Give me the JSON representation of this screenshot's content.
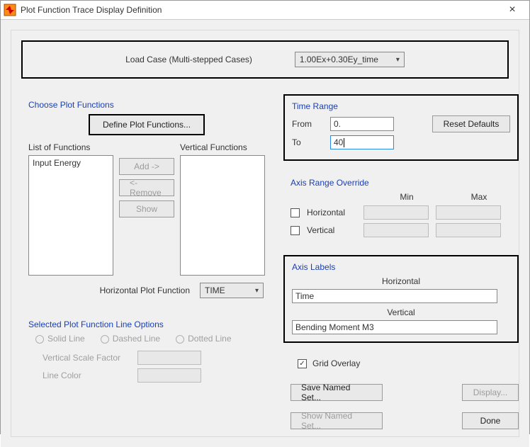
{
  "window": {
    "title": "Plot Function Trace Display Definition",
    "close_label": "×"
  },
  "load_case": {
    "label": "Load Case (Multi-stepped Cases)",
    "selected": "1.00Ex+0.30Ey_time"
  },
  "choose_plot_functions": {
    "title": "Choose Plot Functions",
    "define_btn": "Define Plot Functions...",
    "list_label": "List of Functions",
    "vertical_label": "Vertical Functions",
    "list_items": [
      "Input Energy"
    ],
    "add_btn": "Add ->",
    "remove_btn": "<- Remove",
    "show_btn": "Show",
    "horizontal_label": "Horizontal Plot Function",
    "horizontal_selected": "TIME"
  },
  "line_options": {
    "title": "Selected Plot Function Line Options",
    "solid": "Solid Line",
    "dashed": "Dashed Line",
    "dotted": "Dotted Line",
    "vscale_label": "Vertical  Scale Factor",
    "color_label": "Line Color"
  },
  "time_range": {
    "title": "Time Range",
    "from_label": "From",
    "from_value": "0.",
    "to_label": "To",
    "to_value": "40",
    "reset_btn": "Reset Defaults"
  },
  "axis_override": {
    "title": "Axis Range Override",
    "min": "Min",
    "max": "Max",
    "horizontal": "Horizontal",
    "vertical": "Vertical"
  },
  "axis_labels": {
    "title": "Axis Labels",
    "horizontal_label": "Horizontal",
    "horizontal_value": "Time",
    "vertical_label": "Vertical",
    "vertical_value": "Bending Moment M3"
  },
  "grid_overlay": {
    "label": "Grid Overlay",
    "checked": true
  },
  "actions": {
    "save_named_set": "Save Named Set...",
    "display": "Display...",
    "show_named_set": "Show Named Set...",
    "done": "Done"
  }
}
